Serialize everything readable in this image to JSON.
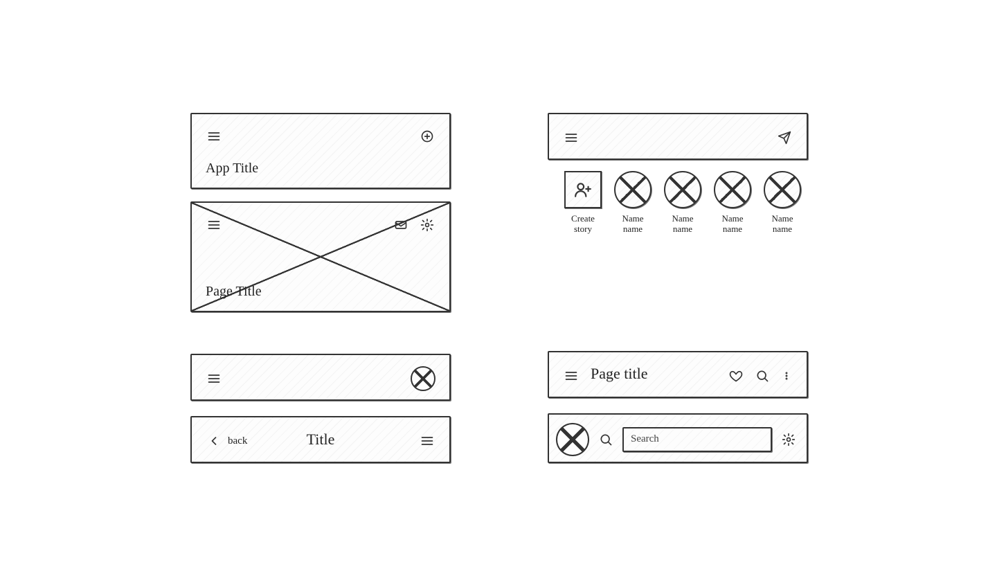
{
  "panel1": {
    "title": "App Title"
  },
  "panel2": {
    "title": "Page Title"
  },
  "panel4": {
    "back_label": "back",
    "title": "Title"
  },
  "panelStories": {
    "create_label": "Create story",
    "items": [
      {
        "label": "Name name"
      },
      {
        "label": "Name name"
      },
      {
        "label": "Name name"
      },
      {
        "label": "Name name"
      }
    ]
  },
  "panel6": {
    "title": "Page title"
  },
  "panel7": {
    "search_placeholder": "Search"
  }
}
